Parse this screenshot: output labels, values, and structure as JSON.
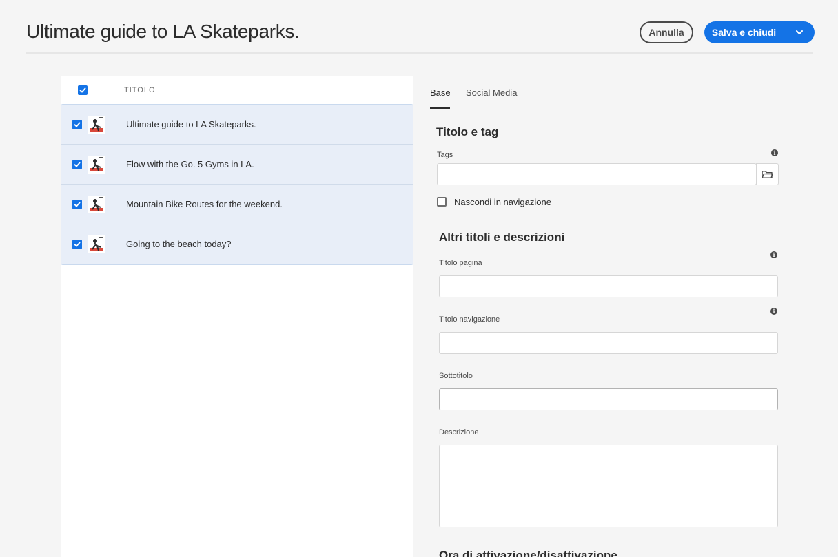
{
  "header": {
    "title": "Ultimate guide to LA Skateparks.",
    "cancel_label": "Annulla",
    "save_label": "Salva e chiudi"
  },
  "list": {
    "column_title": "TITOLO",
    "items": [
      {
        "label": "Ultimate guide to LA Skateparks.",
        "checked": true
      },
      {
        "label": "Flow with the Go. 5 Gyms in LA.",
        "checked": true
      },
      {
        "label": "Mountain Bike Routes for the weekend.",
        "checked": true
      },
      {
        "label": "Going to the beach today?",
        "checked": true
      }
    ]
  },
  "tabs": [
    {
      "label": "Base",
      "active": true
    },
    {
      "label": "Social Media",
      "active": false
    }
  ],
  "form": {
    "section_title_tag": "Titolo e tag",
    "tags_label": "Tags",
    "hide_nav_label": "Nascondi in navigazione",
    "section_other": "Altri titoli e descrizioni",
    "page_title_label": "Titolo pagina",
    "nav_title_label": "Titolo navigazione",
    "subtitle_label": "Sottotitolo",
    "description_label": "Descrizione",
    "section_activation": "Ora di attivazione/disattivazione"
  },
  "colors": {
    "accent": "#1473e6",
    "selected_row": "#e8eef8"
  }
}
